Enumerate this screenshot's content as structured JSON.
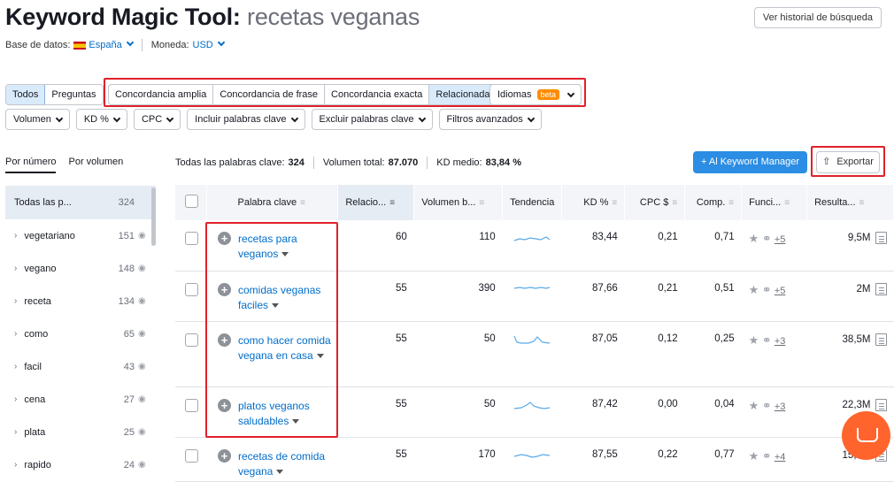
{
  "header": {
    "tool_title": "Keyword Magic Tool:",
    "query": "recetas veganas",
    "history_button": "Ver historial de búsqueda",
    "database_label": "Base de datos:",
    "database_value": "España",
    "currency_label": "Moneda:",
    "currency_value": "USD"
  },
  "modes": {
    "all": "Todos",
    "questions": "Preguntas"
  },
  "match_types": [
    "Concordancia amplia",
    "Concordancia de frase",
    "Concordancia exacta",
    "Relacionadas"
  ],
  "languages": {
    "label": "Idiomas",
    "badge": "beta"
  },
  "filters": [
    "Volumen",
    "KD %",
    "CPC",
    "Incluir palabras clave",
    "Excluir palabras clave",
    "Filtros avanzados"
  ],
  "sidebar": {
    "tab_by_number": "Por número",
    "tab_by_volume": "Por volumen",
    "items": [
      {
        "label": "Todas las p...",
        "count": "324"
      },
      {
        "label": "vegetariano",
        "count": "151"
      },
      {
        "label": "vegano",
        "count": "148"
      },
      {
        "label": "receta",
        "count": "134"
      },
      {
        "label": "como",
        "count": "65"
      },
      {
        "label": "facil",
        "count": "43"
      },
      {
        "label": "cena",
        "count": "27"
      },
      {
        "label": "plata",
        "count": "25"
      },
      {
        "label": "rapido",
        "count": "24"
      }
    ]
  },
  "summary": {
    "all_keywords_label": "Todas las palabras clave:",
    "all_keywords_value": "324",
    "total_volume_label": "Volumen total:",
    "total_volume_value": "87.070",
    "avg_kd_label": "KD medio:",
    "avg_kd_value": "83,84 %"
  },
  "actions": {
    "keyword_manager": "+ Al Keyword Manager",
    "export": "Exportar"
  },
  "table": {
    "headers": [
      "Palabra clave",
      "Relacio...",
      "Volumen b...",
      "Tendencia",
      "KD %",
      "CPC $",
      "Comp.",
      "Funci...",
      "Resulta..."
    ],
    "rows": [
      {
        "keyword": "recetas para veganos",
        "relation": "60",
        "volume": "110",
        "kd": "83,44",
        "cpc": "0,21",
        "comp": "0,71",
        "features": "+5",
        "results": "9,5M"
      },
      {
        "keyword": "comidas veganas faciles",
        "relation": "55",
        "volume": "390",
        "kd": "87,66",
        "cpc": "0,21",
        "comp": "0,51",
        "features": "+5",
        "results": "2M"
      },
      {
        "keyword": "como hacer comida vegana en casa",
        "relation": "55",
        "volume": "50",
        "kd": "87,05",
        "cpc": "0,12",
        "comp": "0,25",
        "features": "+3",
        "results": "38,5M"
      },
      {
        "keyword": "platos veganos saludables",
        "relation": "55",
        "volume": "50",
        "kd": "87,42",
        "cpc": "0,00",
        "comp": "0,04",
        "features": "+3",
        "results": "22,3M"
      },
      {
        "keyword": "recetas de comida vegana",
        "relation": "55",
        "volume": "170",
        "kd": "87,55",
        "cpc": "0,22",
        "comp": "0,77",
        "features": "+4",
        "results": "15,8M"
      }
    ]
  },
  "colors": {
    "accent": "#2b8de3",
    "link": "#006dca",
    "highlight_box": "#e0212a",
    "chat": "#ff642d"
  }
}
